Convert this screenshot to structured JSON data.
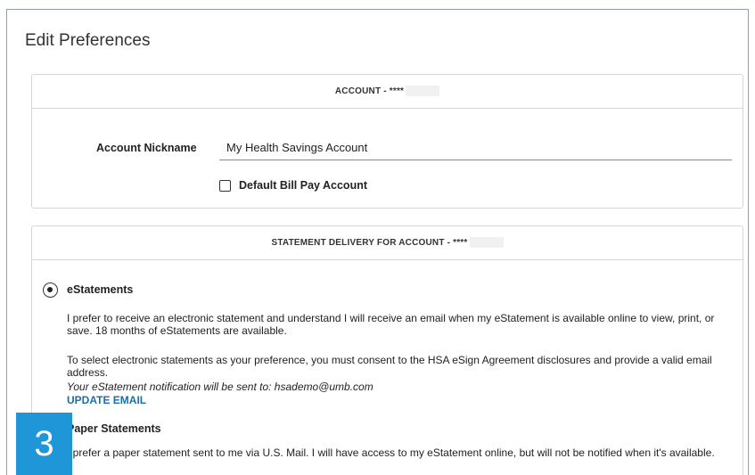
{
  "page": {
    "title": "Edit Preferences"
  },
  "account_card": {
    "header": "ACCOUNT - ****",
    "nickname_label": "Account Nickname",
    "nickname_value": "My Health Savings Account",
    "default_bill_pay_label": "Default Bill Pay Account",
    "default_bill_pay_checked": false
  },
  "statement_card": {
    "header": "STATEMENT DELIVERY FOR ACCOUNT - ****",
    "estatements": {
      "label": "eStatements",
      "selected": true,
      "desc1": "I prefer to receive an electronic statement and understand I will receive an email when my eStatement is available online to view, print, or save. 18 months of eStatements are available.",
      "desc2": "To select electronic statements as your preference, you must consent to the HSA eSign Agreement disclosures and provide a valid email address.",
      "notification": "Your eStatement notification will be sent to: hsademo@umb.com",
      "update_email": "UPDATE EMAIL"
    },
    "paper": {
      "label": "Paper Statements",
      "selected": false,
      "desc": "I prefer a paper statement sent to me via U.S. Mail. I will have access to my eStatement online, but will not be notified when it's available."
    }
  },
  "badge": {
    "number": "3"
  }
}
